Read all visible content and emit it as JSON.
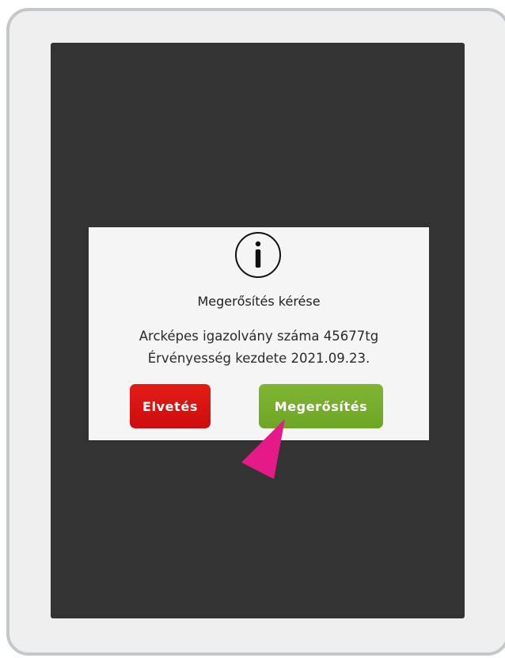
{
  "dialog": {
    "title": "Megerősítés kérése",
    "message_line1": "Arcképes igazolvány száma 45677tg",
    "message_line2": "Érvényesség kezdete 2021.09.23.",
    "icon": "info-icon"
  },
  "buttons": {
    "cancel_label": "Elvetés",
    "confirm_label": "Megerősítés"
  },
  "colors": {
    "screen_background": "#333333",
    "cancel_button": "#d71411",
    "confirm_button": "#76ad2b",
    "pointer_arrow": "#e51a88"
  }
}
